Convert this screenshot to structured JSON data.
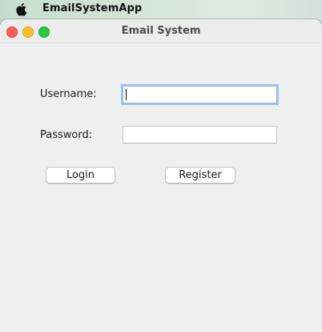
{
  "menubar": {
    "apple_icon": "apple-logo-icon",
    "app_name": "EmailSystemApp"
  },
  "window": {
    "title": "Email System",
    "controls": [
      "close",
      "minimize",
      "zoom"
    ],
    "control_colors": {
      "close": "#fe5f57",
      "minimize": "#febc2e",
      "zoom": "#28c840"
    }
  },
  "form": {
    "username_label": "Username:",
    "username_value": "",
    "password_label": "Password:",
    "password_value": "",
    "login_label": "Login",
    "register_label": "Register"
  }
}
